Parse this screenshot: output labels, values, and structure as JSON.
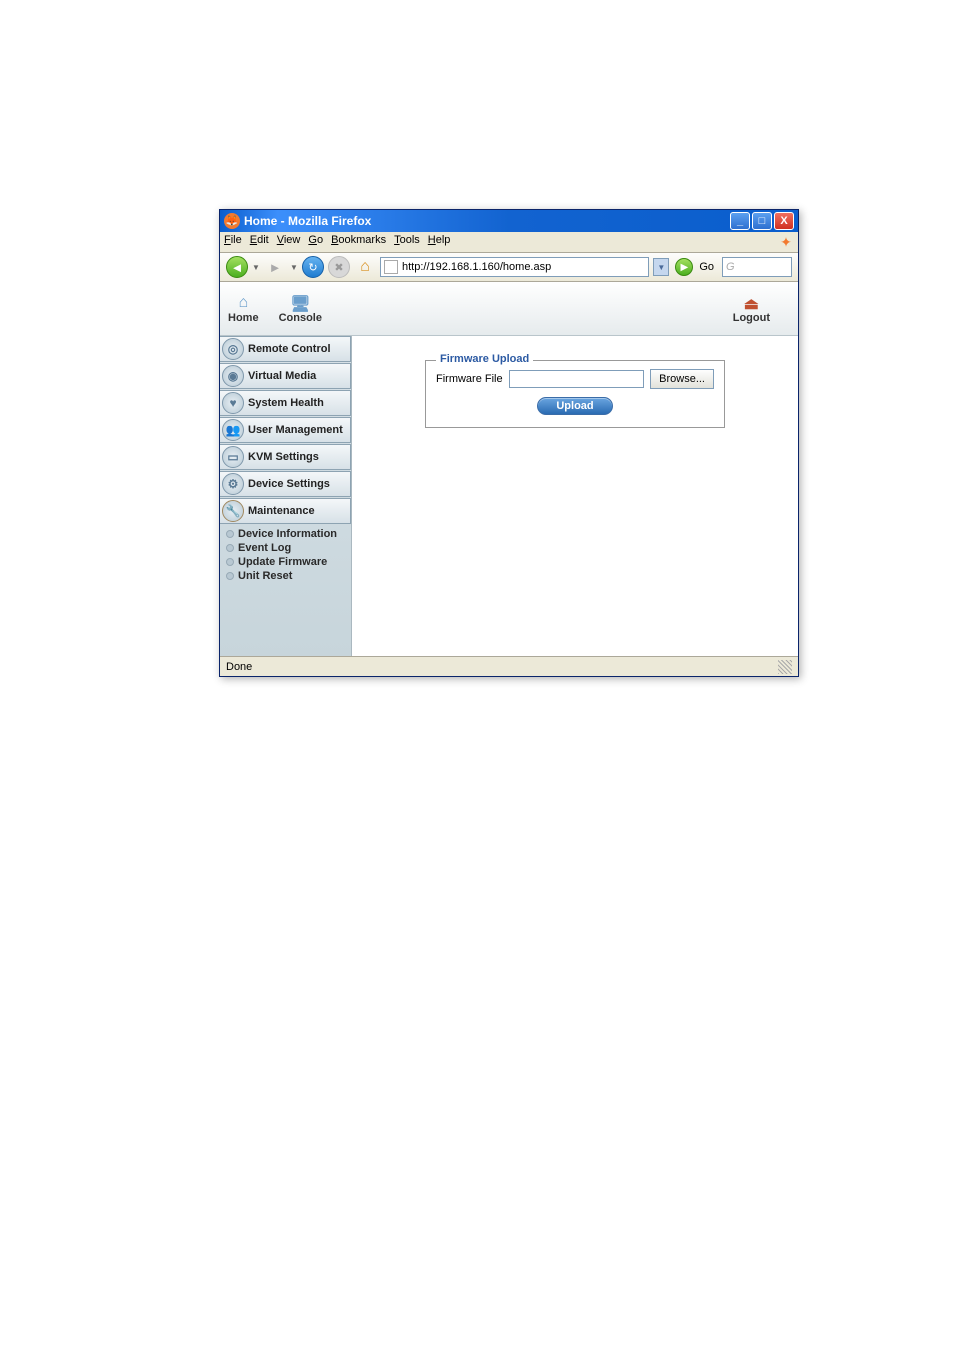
{
  "window": {
    "title": "Home - Mozilla Firefox"
  },
  "menubar": {
    "file": "File",
    "edit": "Edit",
    "view": "View",
    "go": "Go",
    "bookmarks": "Bookmarks",
    "tools": "Tools",
    "help": "Help"
  },
  "toolbar": {
    "url": "http://192.168.1.160/home.asp",
    "go_label": "Go",
    "search_placeholder": "G"
  },
  "header": {
    "home": "Home",
    "console": "Console",
    "logout": "Logout"
  },
  "sidebar": {
    "items": [
      {
        "label": "Remote Control"
      },
      {
        "label": "Virtual Media"
      },
      {
        "label": "System Health"
      },
      {
        "label": "User Management"
      },
      {
        "label": "KVM Settings"
      },
      {
        "label": "Device Settings"
      },
      {
        "label": "Maintenance"
      }
    ],
    "submenu": [
      {
        "label": "Device Information"
      },
      {
        "label": "Event Log"
      },
      {
        "label": "Update Firmware"
      },
      {
        "label": "Unit Reset"
      }
    ]
  },
  "firmware": {
    "legend": "Firmware Upload",
    "label": "Firmware File",
    "browse": "Browse...",
    "upload": "Upload"
  },
  "statusbar": {
    "text": "Done"
  }
}
